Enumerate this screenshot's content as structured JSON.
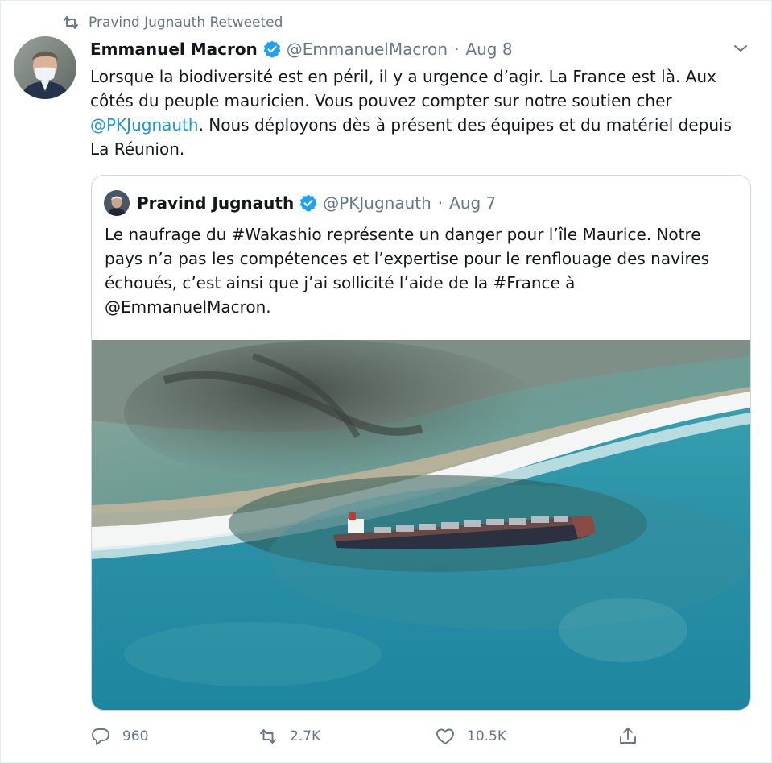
{
  "retweet": {
    "label": "Pravind Jugnauth Retweeted",
    "icon": "retweet-icon"
  },
  "tweet": {
    "author": {
      "name": "Emmanuel Macron",
      "handle": "@EmmanuelMacron",
      "verified": true
    },
    "separator": "·",
    "date": "Aug 8",
    "text_before_mention": "Lorsque la biodiversité est en péril, il y a urgence d’agir. La France est là. Aux côtés du peuple mauricien. Vous pouvez compter sur notre soutien cher ",
    "mention": "@PKJugnauth",
    "text_after_mention": ". Nous déployons dès à présent des équipes et du matériel depuis La Réunion."
  },
  "quoted_tweet": {
    "author": {
      "name": "Pravind Jugnauth",
      "handle": "@PKJugnauth",
      "verified": true
    },
    "separator": "·",
    "date": "Aug 7",
    "text": "Le naufrage du #Wakashio représente un danger pour l’île Maurice. Notre pays n’a pas les compétences et l’expertise pour le renflouage des navires échoués, c’est ainsi que j’ai sollicité l’aide de la #France à @EmmanuelMacron."
  },
  "actions": {
    "reply_count": "960",
    "retweet_count": "2.7K",
    "like_count": "10.5K",
    "icons": [
      "reply-icon",
      "retweet-icon",
      "like-icon",
      "share-icon"
    ]
  },
  "colors": {
    "link": "#1b95e0",
    "verified": "#1da1f2",
    "secondary_text": "#657786",
    "primary_text": "#14171a",
    "border": "#ccd6dd"
  }
}
